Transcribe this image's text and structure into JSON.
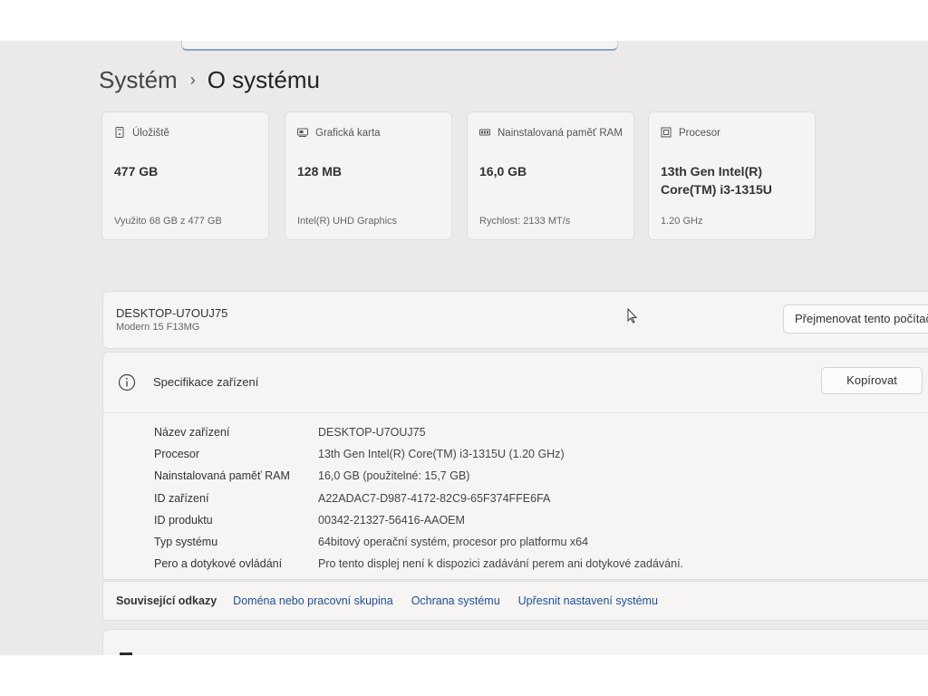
{
  "breadcrumb": {
    "parent": "Systém",
    "separator": "›",
    "current": "O systému"
  },
  "cards": [
    {
      "icon": "storage-icon",
      "title": "Úložiště",
      "value": "477 GB",
      "sub": "Využito 68 GB z 477 GB"
    },
    {
      "icon": "graphics-card-icon",
      "title": "Grafická karta",
      "value": "128 MB",
      "sub": "Intel(R) UHD Graphics"
    },
    {
      "icon": "memory-icon",
      "title": "Nainstalovaná paměť RAM",
      "value": "16,0 GB",
      "sub": "Rychlost: 2133 MT/s"
    },
    {
      "icon": "processor-icon",
      "title": "Procesor",
      "value": "13th Gen Intel(R) Core(TM) i3-1315U",
      "sub": "1.20 GHz"
    }
  ],
  "device": {
    "name": "DESKTOP-U7OUJ75",
    "model": "Modern 15 F13MG",
    "rename_button": "Přejmenovat tento počítač"
  },
  "specs": {
    "title": "Specifikace zařízení",
    "copy_button": "Kopírovat",
    "rows": [
      {
        "label": "Název zařízení",
        "value": "DESKTOP-U7OUJ75"
      },
      {
        "label": "Procesor",
        "value": "13th Gen Intel(R) Core(TM) i3-1315U (1.20 GHz)"
      },
      {
        "label": "Nainstalovaná paměť RAM",
        "value": "16,0 GB (použitelné: 15,7 GB)"
      },
      {
        "label": "ID zařízení",
        "value": "A22ADAC7-D987-4172-82C9-65F374FFE6FA"
      },
      {
        "label": "ID produktu",
        "value": "00342-21327-56416-AAOEM"
      },
      {
        "label": "Typ systému",
        "value": "64bitový operační systém, procesor pro platformu x64"
      },
      {
        "label": "Pero a dotykové ovládání",
        "value": "Pro tento displej není k dispozici zadávání perem ani dotykové zadávání."
      }
    ]
  },
  "related_links": {
    "label": "Související odkazy",
    "links": [
      "Doména nebo pracovní skupina",
      "Ochrana systému",
      "Upřesnit nastavení systému"
    ]
  }
}
